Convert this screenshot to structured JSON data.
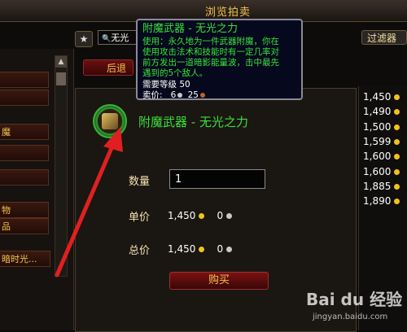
{
  "window": {
    "title": "浏览拍卖"
  },
  "search": {
    "value": "无光"
  },
  "toolbar": {
    "star_icon": "star-icon",
    "filter_label": "过滤器"
  },
  "nav": {
    "back_label": "后退"
  },
  "left_list": {
    "items": [
      "",
      "",
      "魔",
      "",
      "",
      "物",
      "品",
      "暗时光..."
    ]
  },
  "item": {
    "name": "附魔武器 - 无光之力",
    "quality_color": "#3ae03a"
  },
  "purchase": {
    "quantity_label": "数量",
    "quantity_value": "1",
    "unit_price_label": "单价",
    "unit_price_gold": "1,450",
    "unit_price_silver": "0",
    "total_price_label": "总价",
    "total_price_gold": "1,450",
    "total_price_silver": "0",
    "buy_label": "购买"
  },
  "price_list": [
    "1,450",
    "1,490",
    "1,500",
    "1,599",
    "1,600",
    "1,600",
    "1,885",
    "1,890"
  ],
  "tooltip": {
    "name": "附魔武器 - 无光之力",
    "use_line1": "使用：永久地为一件武器附魔，你在",
    "use_line2": "使用攻击法术和技能时有一定几率对",
    "use_line3": "前方发出一道暗影能量波，击中最先",
    "use_line4": "遇到的5个敌人。",
    "level_req": "需要等级 50",
    "sell_label": "卖价:",
    "sell_silver": "6",
    "sell_copper": "25"
  },
  "watermark": {
    "logo": "Bai du 经验",
    "url": "jingyan.baidu.com"
  },
  "colors": {
    "gold": "#f4c64a",
    "uncommon_green": "#3ae03a",
    "button_red": "#7a1212"
  }
}
